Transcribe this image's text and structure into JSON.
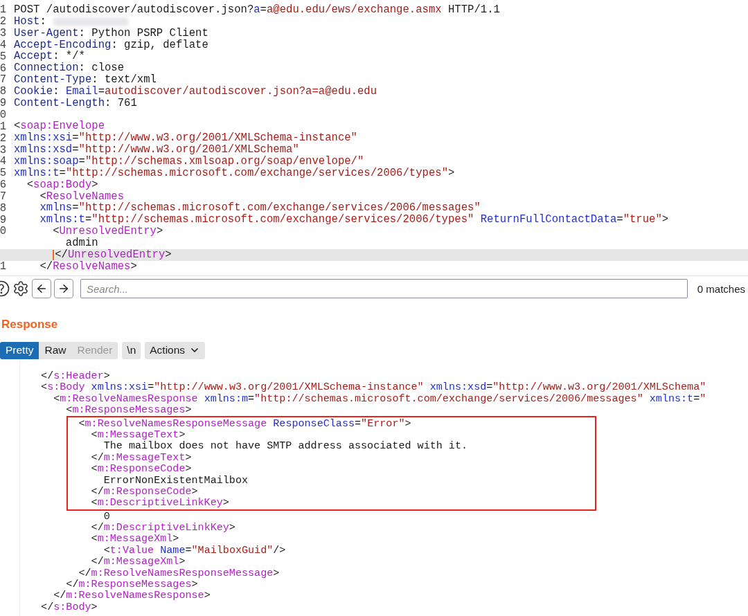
{
  "request": {
    "lines": [
      {
        "num": "1",
        "tokens": [
          {
            "kind": "plain",
            "text": "POST /autodiscover/autodiscover.json?"
          },
          {
            "kind": "attr",
            "text": "a"
          },
          {
            "kind": "plain",
            "text": "="
          },
          {
            "kind": "value",
            "text": "a@edu.edu/ews/exchange.asmx"
          },
          {
            "kind": "plain",
            "text": " HTTP/1.1"
          }
        ]
      },
      {
        "num": "2",
        "tokens": [
          {
            "kind": "header",
            "text": "Host"
          },
          {
            "kind": "plain",
            "text": ": "
          }
        ],
        "redacted": true
      },
      {
        "num": "3",
        "tokens": [
          {
            "kind": "header",
            "text": "User-Agent"
          },
          {
            "kind": "plain",
            "text": ": Python PSRP Client"
          }
        ]
      },
      {
        "num": "4",
        "tokens": [
          {
            "kind": "header",
            "text": "Accept-Encoding"
          },
          {
            "kind": "plain",
            "text": ": gzip, deflate"
          }
        ]
      },
      {
        "num": "5",
        "tokens": [
          {
            "kind": "header",
            "text": "Accept"
          },
          {
            "kind": "plain",
            "text": ": */*"
          }
        ]
      },
      {
        "num": "6",
        "tokens": [
          {
            "kind": "header",
            "text": "Connection"
          },
          {
            "kind": "plain",
            "text": ": close"
          }
        ]
      },
      {
        "num": "7",
        "tokens": [
          {
            "kind": "header",
            "text": "Content-Type"
          },
          {
            "kind": "plain",
            "text": ": text/xml"
          }
        ]
      },
      {
        "num": "8",
        "tokens": [
          {
            "kind": "header",
            "text": "Cookie"
          },
          {
            "kind": "plain",
            "text": ": "
          },
          {
            "kind": "attr",
            "text": "Email"
          },
          {
            "kind": "plain",
            "text": "="
          },
          {
            "kind": "value",
            "text": "autodiscover/autodiscover.json?a=a@edu.edu"
          }
        ]
      },
      {
        "num": "9",
        "tokens": [
          {
            "kind": "header",
            "text": "Content-Length"
          },
          {
            "kind": "plain",
            "text": ": 761"
          }
        ]
      },
      {
        "num": "0"
      },
      {
        "num": "1",
        "tokens": [
          {
            "kind": "plain",
            "text": "<"
          },
          {
            "kind": "tag",
            "text": "soap:Envelope"
          }
        ]
      },
      {
        "num": "2",
        "tokens": [
          {
            "kind": "attr",
            "text": "xmlns:xsi"
          },
          {
            "kind": "plain",
            "text": "="
          },
          {
            "kind": "value",
            "text": "\"http://www.w3.org/2001/XMLSchema-instance\""
          }
        ]
      },
      {
        "num": "3",
        "tokens": [
          {
            "kind": "attr",
            "text": "xmlns:xsd"
          },
          {
            "kind": "plain",
            "text": "="
          },
          {
            "kind": "value",
            "text": "\"http://www.w3.org/2001/XMLSchema\""
          }
        ]
      },
      {
        "num": "4",
        "tokens": [
          {
            "kind": "attr",
            "text": "xmlns:soap"
          },
          {
            "kind": "plain",
            "text": "="
          },
          {
            "kind": "value",
            "text": "\"http://schemas.xmlsoap.org/soap/envelope/\""
          }
        ]
      },
      {
        "num": "5",
        "tokens": [
          {
            "kind": "attr",
            "text": "xmlns:t"
          },
          {
            "kind": "plain",
            "text": "="
          },
          {
            "kind": "value",
            "text": "\"http://schemas.microsoft.com/exchange/services/2006/types\""
          },
          {
            "kind": "plain",
            "text": ">"
          }
        ]
      },
      {
        "num": "6",
        "tokens": [
          {
            "kind": "plain",
            "text": "  <"
          },
          {
            "kind": "tag",
            "text": "soap:Body"
          },
          {
            "kind": "plain",
            "text": ">"
          }
        ]
      },
      {
        "num": "7",
        "tokens": [
          {
            "kind": "plain",
            "text": "    <"
          },
          {
            "kind": "tag",
            "text": "ResolveNames"
          }
        ]
      },
      {
        "num": "8",
        "tokens": [
          {
            "kind": "attr",
            "text": "    xmlns"
          },
          {
            "kind": "plain",
            "text": "="
          },
          {
            "kind": "value",
            "text": "\"http://schemas.microsoft.com/exchange/services/2006/messages\""
          }
        ]
      },
      {
        "num": "9",
        "tokens": [
          {
            "kind": "attr",
            "text": "    xmlns:t"
          },
          {
            "kind": "plain",
            "text": "="
          },
          {
            "kind": "value",
            "text": "\"http://schemas.microsoft.com/exchange/services/2006/types\""
          },
          {
            "kind": "attr",
            "text": " ReturnFullContactData"
          },
          {
            "kind": "plain",
            "text": "="
          },
          {
            "kind": "value",
            "text": "\"true\""
          },
          {
            "kind": "plain",
            "text": ">"
          }
        ]
      },
      {
        "num": "0",
        "tokens": [
          {
            "kind": "plain",
            "text": "      <"
          },
          {
            "kind": "tag",
            "text": "UnresolvedEntry"
          },
          {
            "kind": "plain",
            "text": ">"
          }
        ]
      },
      {
        "tokens": [
          {
            "kind": "plain",
            "text": "        admin"
          }
        ]
      },
      {
        "tokens": [
          {
            "kind": "plain",
            "text": "      </"
          },
          {
            "kind": "tag",
            "text": "UnresolvedEntry"
          },
          {
            "kind": "plain",
            "text": ">"
          }
        ],
        "highlighted": true,
        "caret": true
      },
      {
        "num": "1",
        "tokens": [
          {
            "kind": "plain",
            "text": "    </"
          },
          {
            "kind": "tag",
            "text": "ResolveNames"
          },
          {
            "kind": "plain",
            "text": ">"
          }
        ]
      }
    ]
  },
  "search": {
    "placeholder": "Search...",
    "matches": "0 matches"
  },
  "response": {
    "title": "Response",
    "tabs": [
      {
        "label": "Pretty",
        "selected": true,
        "disabled": false
      },
      {
        "label": "Raw",
        "selected": false,
        "disabled": false
      },
      {
        "label": "Render",
        "selected": false,
        "disabled": true
      }
    ],
    "newline_button": "\\n",
    "actions_button": "Actions",
    "blocks": [
      {
        "kind": "plain",
        "lines": [
          {
            "tokens": [
              {
                "kind": "plain",
                "text": "  </"
              },
              {
                "kind": "tag",
                "text": "s:Header"
              },
              {
                "kind": "plain",
                "text": ">"
              }
            ]
          },
          {
            "tokens": [
              {
                "kind": "plain",
                "text": "  <"
              },
              {
                "kind": "tag",
                "text": "s:Body"
              },
              {
                "kind": "attr",
                "text": " xmlns:xsi"
              },
              {
                "kind": "plain",
                "text": "="
              },
              {
                "kind": "value",
                "text": "\"http://www.w3.org/2001/XMLSchema-instance\""
              },
              {
                "kind": "attr",
                "text": " xmlns:xsd"
              },
              {
                "kind": "plain",
                "text": "="
              },
              {
                "kind": "value",
                "text": "\"http://www.w3.org/2001/XMLSchema\""
              }
            ]
          },
          {
            "tokens": [
              {
                "kind": "plain",
                "text": "    <"
              },
              {
                "kind": "tag",
                "text": "m:ResolveNamesResponse"
              },
              {
                "kind": "attr",
                "text": " xmlns:m"
              },
              {
                "kind": "plain",
                "text": "="
              },
              {
                "kind": "value",
                "text": "\"http://schemas.microsoft.com/exchange/services/2006/messages\""
              },
              {
                "kind": "attr",
                "text": " xmlns:t"
              },
              {
                "kind": "plain",
                "text": "="
              },
              {
                "kind": "value",
                "text": "\""
              }
            ]
          },
          {
            "tokens": [
              {
                "kind": "plain",
                "text": "      <"
              },
              {
                "kind": "tag",
                "text": "m:ResponseMessages"
              },
              {
                "kind": "plain",
                "text": ">"
              }
            ]
          }
        ]
      },
      {
        "kind": "framed",
        "lines": [
          {
            "tokens": [
              {
                "kind": "plain",
                "text": "        <"
              },
              {
                "kind": "tag",
                "text": "m:ResolveNamesResponseMessage"
              },
              {
                "kind": "attr",
                "text": " ResponseClass"
              },
              {
                "kind": "plain",
                "text": "="
              },
              {
                "kind": "value",
                "text": "\"Error\""
              },
              {
                "kind": "plain",
                "text": ">"
              }
            ]
          },
          {
            "tokens": [
              {
                "kind": "plain",
                "text": "          <"
              },
              {
                "kind": "tag",
                "text": "m:MessageText"
              },
              {
                "kind": "plain",
                "text": ">"
              }
            ]
          },
          {
            "tokens": [
              {
                "kind": "plain",
                "text": "            The mailbox does not have SMTP address associated with it."
              }
            ]
          },
          {
            "tokens": [
              {
                "kind": "plain",
                "text": "          </"
              },
              {
                "kind": "tag",
                "text": "m:MessageText"
              },
              {
                "kind": "plain",
                "text": ">"
              }
            ]
          },
          {
            "tokens": [
              {
                "kind": "plain",
                "text": "          <"
              },
              {
                "kind": "tag",
                "text": "m:ResponseCode"
              },
              {
                "kind": "plain",
                "text": ">"
              }
            ]
          },
          {
            "tokens": [
              {
                "kind": "plain",
                "text": "            ErrorNonExistentMailbox"
              }
            ]
          },
          {
            "tokens": [
              {
                "kind": "plain",
                "text": "          </"
              },
              {
                "kind": "tag",
                "text": "m:ResponseCode"
              },
              {
                "kind": "plain",
                "text": ">"
              }
            ]
          },
          {
            "tokens": [
              {
                "kind": "plain",
                "text": "          <"
              },
              {
                "kind": "tag",
                "text": "m:DescriptiveLinkKey"
              },
              {
                "kind": "plain",
                "text": ">"
              }
            ]
          }
        ]
      },
      {
        "kind": "plain",
        "lines": [
          {
            "tokens": [
              {
                "kind": "plain",
                "text": "            0"
              }
            ]
          },
          {
            "tokens": [
              {
                "kind": "plain",
                "text": "          </"
              },
              {
                "kind": "tag",
                "text": "m:DescriptiveLinkKey"
              },
              {
                "kind": "plain",
                "text": ">"
              }
            ]
          },
          {
            "tokens": [
              {
                "kind": "plain",
                "text": "          <"
              },
              {
                "kind": "tag",
                "text": "m:MessageXml"
              },
              {
                "kind": "plain",
                "text": ">"
              }
            ]
          },
          {
            "tokens": [
              {
                "kind": "plain",
                "text": "            <"
              },
              {
                "kind": "tag",
                "text": "t:Value"
              },
              {
                "kind": "attr",
                "text": " Name"
              },
              {
                "kind": "plain",
                "text": "="
              },
              {
                "kind": "value",
                "text": "\"MailboxGuid\""
              },
              {
                "kind": "plain",
                "text": "/>"
              }
            ]
          },
          {
            "tokens": [
              {
                "kind": "plain",
                "text": "          </"
              },
              {
                "kind": "tag",
                "text": "m:MessageXml"
              },
              {
                "kind": "plain",
                "text": ">"
              }
            ]
          },
          {
            "tokens": [
              {
                "kind": "plain",
                "text": "        </"
              },
              {
                "kind": "tag",
                "text": "m:ResolveNamesResponseMessage"
              },
              {
                "kind": "plain",
                "text": ">"
              }
            ]
          },
          {
            "tokens": [
              {
                "kind": "plain",
                "text": "      </"
              },
              {
                "kind": "tag",
                "text": "m:ResponseMessages"
              },
              {
                "kind": "plain",
                "text": ">"
              }
            ]
          },
          {
            "tokens": [
              {
                "kind": "plain",
                "text": "    </"
              },
              {
                "kind": "tag",
                "text": "m:ResolveNamesResponse"
              },
              {
                "kind": "plain",
                "text": ">"
              }
            ]
          },
          {
            "tokens": [
              {
                "kind": "plain",
                "text": "  </"
              },
              {
                "kind": "tag",
                "text": "s:Body"
              },
              {
                "kind": "plain",
                "text": ">"
              }
            ]
          }
        ]
      }
    ]
  }
}
